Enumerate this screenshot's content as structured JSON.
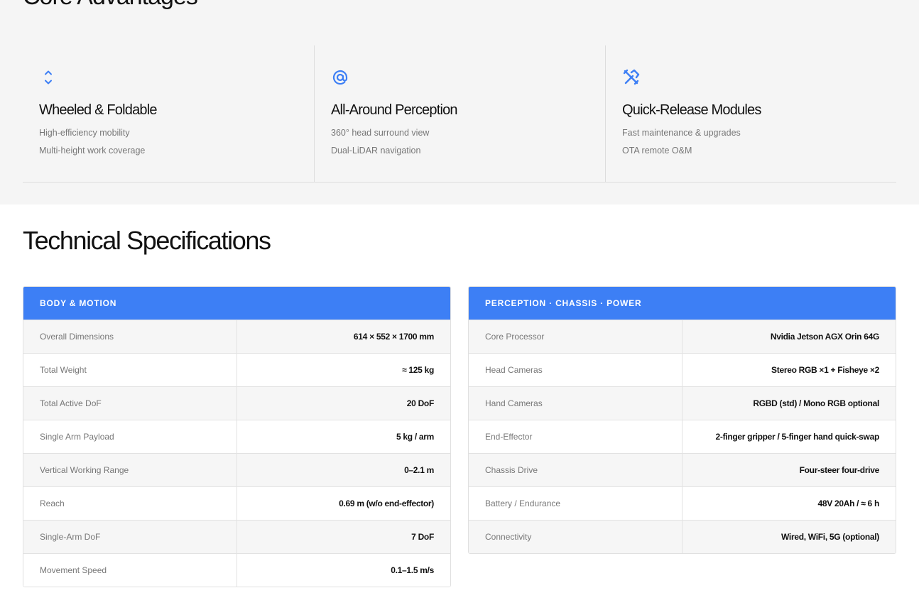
{
  "advantages": {
    "title": "Core Advantages",
    "cards": [
      {
        "icon": "chevron-up-down-icon",
        "heading": "Wheeled & Foldable",
        "lines": [
          "High-efficiency mobility",
          "Multi-height work coverage"
        ]
      },
      {
        "icon": "target-at-icon",
        "heading": "All-Around Perception",
        "lines": [
          "360° head surround view",
          "Dual-LiDAR navigation"
        ]
      },
      {
        "icon": "tools-icon",
        "heading": "Quick-Release Modules",
        "lines": [
          "Fast maintenance & upgrades",
          "OTA remote O&M"
        ]
      }
    ]
  },
  "specs": {
    "title": "Technical Specifications",
    "accent_color": "#3d7ff5",
    "tables": [
      {
        "header": "BODY & MOTION",
        "rows": [
          {
            "key": "Overall Dimensions",
            "value": "614 × 552 × 1700 mm"
          },
          {
            "key": "Total Weight",
            "value": "≈ 125 kg"
          },
          {
            "key": "Total Active DoF",
            "value": "20 DoF"
          },
          {
            "key": "Single Arm Payload",
            "value": "5 kg / arm"
          },
          {
            "key": "Vertical Working Range",
            "value": "0–2.1 m"
          },
          {
            "key": "Reach",
            "value": "0.69 m (w/o end-effector)"
          },
          {
            "key": "Single-Arm DoF",
            "value": "7 DoF"
          },
          {
            "key": "Movement Speed",
            "value": "0.1–1.5 m/s"
          }
        ]
      },
      {
        "header": "PERCEPTION · CHASSIS · POWER",
        "rows": [
          {
            "key": "Core Processor",
            "value": "Nvidia Jetson AGX Orin 64G"
          },
          {
            "key": "Head Cameras",
            "value": "Stereo RGB ×1 + Fisheye ×2"
          },
          {
            "key": "Hand Cameras",
            "value": "RGBD (std) / Mono RGB optional"
          },
          {
            "key": "End-Effector",
            "value": "2-finger gripper / 5-finger hand quick-swap"
          },
          {
            "key": "Chassis Drive",
            "value": "Four-steer four-drive"
          },
          {
            "key": "Battery / Endurance",
            "value": "48V 20Ah / ≈ 6 h"
          },
          {
            "key": "Connectivity",
            "value": "Wired, WiFi, 5G (optional)"
          }
        ]
      }
    ]
  }
}
